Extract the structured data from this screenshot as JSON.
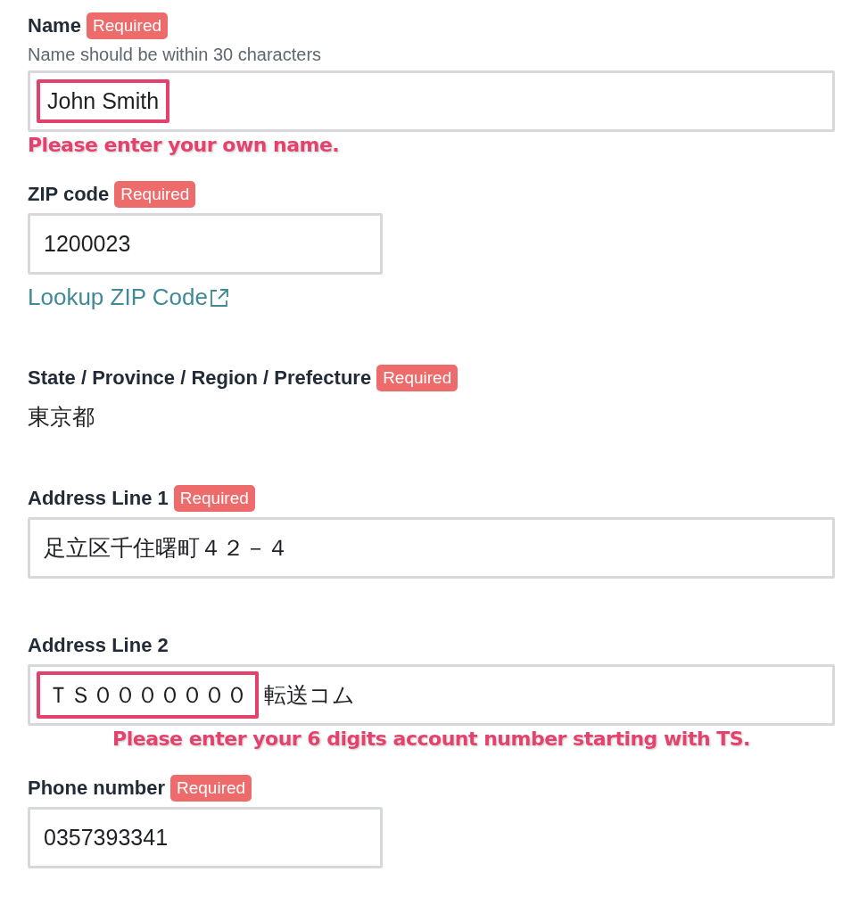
{
  "fields": [
    {
      "kind": "wide_input",
      "label": "Name",
      "badge": "Required",
      "hint": "Name should be within 30 characters",
      "value_parts": [
        {
          "text": "John Smith",
          "highlighted": true
        }
      ],
      "annotation": "Please enter your own name."
    },
    {
      "kind": "narrow_input",
      "label": "ZIP code",
      "badge": "Required",
      "value_parts": [
        {
          "text": "1200023",
          "highlighted": false
        }
      ],
      "link": "Lookup ZIP Code"
    },
    {
      "kind": "static",
      "label": "State / Province / Region / Prefecture",
      "badge": "Required",
      "value": "東京都"
    },
    {
      "kind": "wide_input",
      "label": "Address Line 1",
      "badge": "Required",
      "value_parts": [
        {
          "text": "足立区千住曙町４２－４",
          "highlighted": false
        }
      ]
    },
    {
      "kind": "wide_input",
      "label": "Address Line 2",
      "value_parts": [
        {
          "text": "ＴＳ０００００００",
          "highlighted": true
        },
        {
          "text": "転送コム",
          "highlighted": false
        }
      ],
      "annotation": "Please enter your 6 digits account number starting with TS."
    },
    {
      "kind": "narrow_input",
      "label": "Phone number",
      "badge": "Required",
      "value_parts": [
        {
          "text": "0357393341",
          "highlighted": false
        }
      ]
    }
  ]
}
